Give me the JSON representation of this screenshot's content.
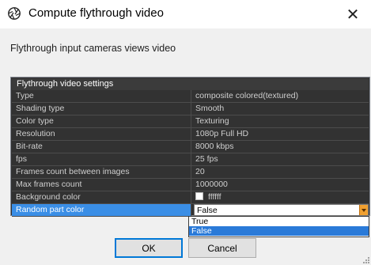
{
  "window": {
    "title": "Compute flythrough video",
    "close_glyph": "✕"
  },
  "subtitle": "Flythrough input cameras views video",
  "table": {
    "group_header": "Flythrough video settings",
    "rows": [
      {
        "name": "Type",
        "value": "composite colored(textured)"
      },
      {
        "name": "Shading type",
        "value": "Smooth"
      },
      {
        "name": "Color type",
        "value": "Texturing"
      },
      {
        "name": "Resolution",
        "value": "1080p Full HD"
      },
      {
        "name": "Bit-rate",
        "value": "8000 kbps"
      },
      {
        "name": "fps",
        "value": "25 fps"
      },
      {
        "name": "Frames count between images",
        "value": "20"
      },
      {
        "name": "Max frames count",
        "value": "1000000"
      },
      {
        "name": "Background color",
        "value": "ffffff",
        "swatch_color": "#ffffff"
      },
      {
        "name": "Random part color",
        "value": "False"
      }
    ]
  },
  "dropdown": {
    "options": [
      "True",
      "False"
    ],
    "selected": "False"
  },
  "buttons": {
    "ok": "OK",
    "cancel": "Cancel"
  },
  "colors": {
    "accent": "#0078d7",
    "selection": "#3a8ee6",
    "combo_arrow": "#f0a030",
    "table_bg": "#323232"
  },
  "icons": [
    "aperture-app-icon",
    "close-icon",
    "combo-arrow-icon",
    "resize-grip-icon"
  ]
}
